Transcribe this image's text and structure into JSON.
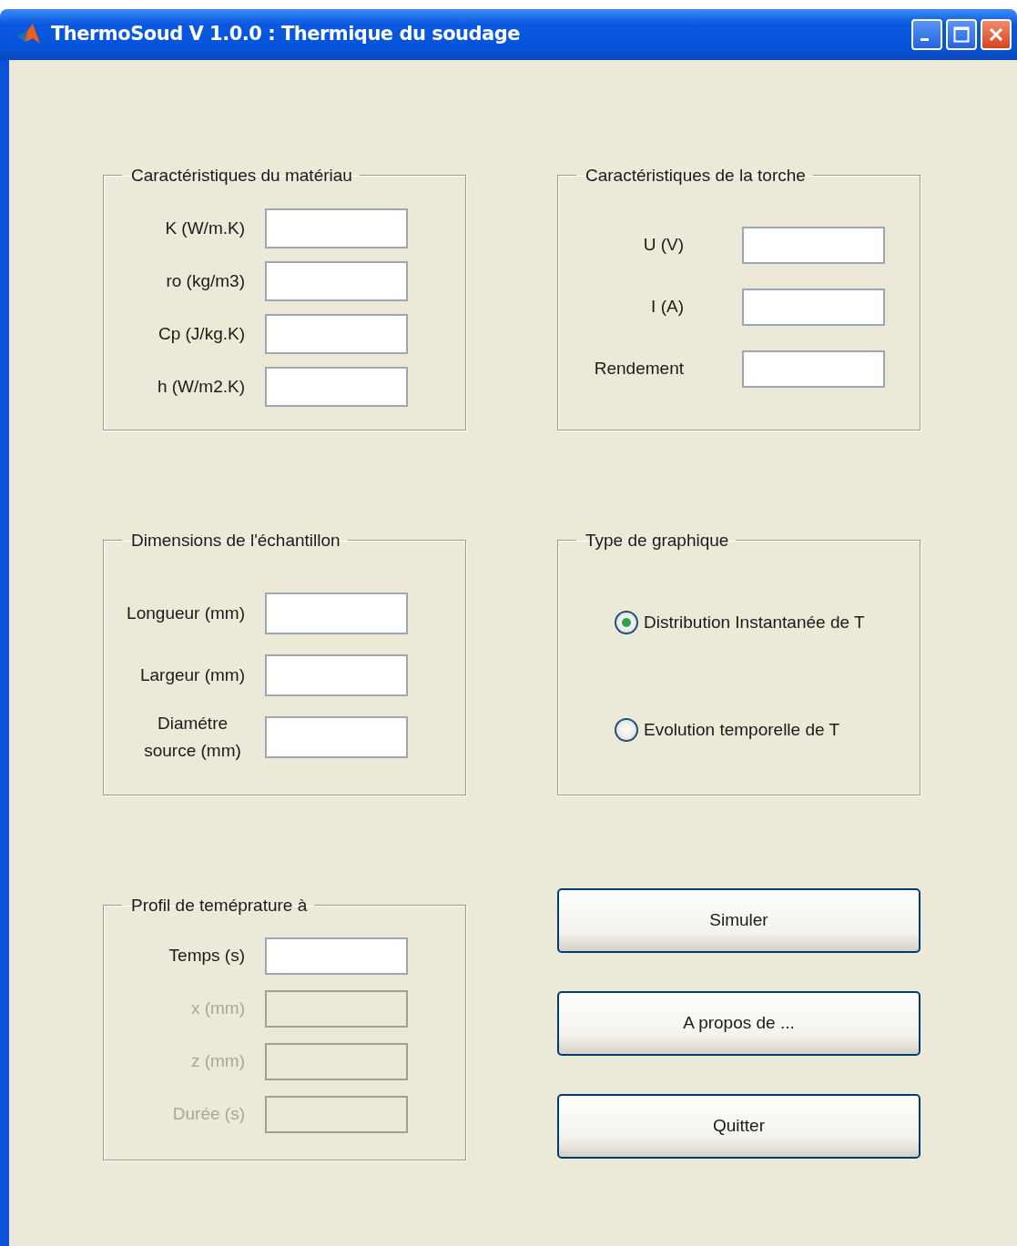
{
  "window": {
    "title": "ThermoSoud V 1.0.0 : Thermique du soudage"
  },
  "panels": [
    {
      "title": "Caractéristiques du matériau",
      "kind": "fields",
      "fields": [
        {
          "label": "K (W/m.K)",
          "disabled": false
        },
        {
          "label": "ro (kg/m3)",
          "disabled": false
        },
        {
          "label": "Cp (J/kg.K)",
          "disabled": false
        },
        {
          "label": "h (W/m2.K)",
          "disabled": false
        }
      ]
    },
    {
      "title": "Caractéristiques de la torche",
      "kind": "fields",
      "fields": [
        {
          "label": "U (V)",
          "disabled": false
        },
        {
          "label": "I (A)",
          "disabled": false
        },
        {
          "label": "Rendement",
          "disabled": false
        }
      ]
    },
    {
      "title": "Dimensions de l'échantillon",
      "kind": "fields",
      "fields": [
        {
          "label": "Longueur (mm)",
          "disabled": false
        },
        {
          "label": "Largeur (mm)",
          "disabled": false
        },
        {
          "label": "Diamétre source (mm)",
          "disabled": false
        }
      ]
    },
    {
      "title": "Type de graphique",
      "kind": "radios",
      "options": [
        {
          "label": "Distribution Instantanée de T",
          "selected": true
        },
        {
          "label": "Evolution temporelle de T",
          "selected": false
        }
      ]
    },
    {
      "title": "Profil de teméprature à",
      "kind": "fields",
      "fields": [
        {
          "label": "Temps (s)",
          "disabled": false
        },
        {
          "label": "x (mm)",
          "disabled": true
        },
        {
          "label": "z (mm)",
          "disabled": true
        },
        {
          "label": "Durée (s)",
          "disabled": true
        }
      ]
    }
  ],
  "buttons": [
    "Simuler",
    "A propos de ...",
    "Quitter"
  ]
}
